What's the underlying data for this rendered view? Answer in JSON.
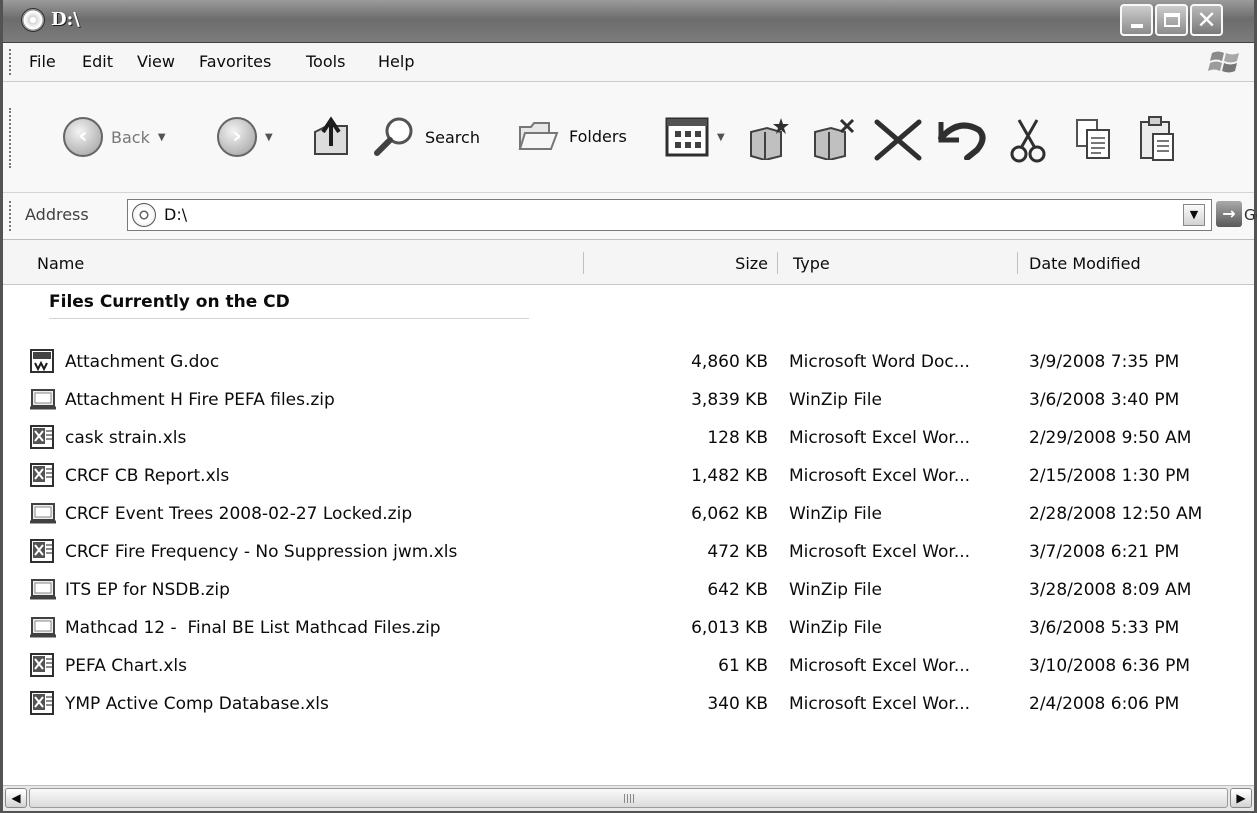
{
  "window": {
    "title": "D:\\",
    "icon": "cd-drive-icon",
    "controls": [
      "minimize",
      "maximize",
      "close"
    ]
  },
  "menu": {
    "items": [
      "File",
      "Edit",
      "View",
      "Favorites",
      "Tools",
      "Help"
    ]
  },
  "toolbar": {
    "back_label": "Back",
    "search_label": "Search",
    "folders_label": "Folders"
  },
  "address": {
    "label": "Address",
    "value": "D:\\",
    "go_label": "Go"
  },
  "columns": {
    "name": "Name",
    "size": "Size",
    "type": "Type",
    "date": "Date Modified"
  },
  "group": {
    "heading": "Files Currently on the CD"
  },
  "files": [
    {
      "name": "Attachment G.doc",
      "size": "4,860 KB",
      "type": "Microsoft Word Doc...",
      "date": "3/9/2008 7:35 PM",
      "icon": "word-doc-icon"
    },
    {
      "name": "Attachment H Fire PEFA files.zip",
      "size": "3,839 KB",
      "type": "WinZip File",
      "date": "3/6/2008 3:40 PM",
      "icon": "zip-file-icon"
    },
    {
      "name": "cask strain.xls",
      "size": "128 KB",
      "type": "Microsoft Excel Wor...",
      "date": "2/29/2008 9:50 AM",
      "icon": "excel-file-icon"
    },
    {
      "name": "CRCF CB Report.xls",
      "size": "1,482 KB",
      "type": "Microsoft Excel Wor...",
      "date": "2/15/2008 1:30 PM",
      "icon": "excel-file-icon"
    },
    {
      "name": "CRCF Event Trees 2008-02-27 Locked.zip",
      "size": "6,062 KB",
      "type": "WinZip File",
      "date": "2/28/2008 12:50 AM",
      "icon": "zip-file-icon"
    },
    {
      "name": "CRCF Fire Frequency - No Suppression jwm.xls",
      "size": "472 KB",
      "type": "Microsoft Excel Wor...",
      "date": "3/7/2008 6:21 PM",
      "icon": "excel-file-icon"
    },
    {
      "name": "ITS EP for NSDB.zip",
      "size": "642 KB",
      "type": "WinZip File",
      "date": "3/28/2008 8:09 AM",
      "icon": "zip-file-icon"
    },
    {
      "name": "Mathcad 12 -  Final BE List Mathcad Files.zip",
      "size": "6,013 KB",
      "type": "WinZip File",
      "date": "3/6/2008 5:33 PM",
      "icon": "zip-file-icon"
    },
    {
      "name": "PEFA Chart.xls",
      "size": "61 KB",
      "type": "Microsoft Excel Wor...",
      "date": "3/10/2008 6:36 PM",
      "icon": "excel-file-icon"
    },
    {
      "name": "YMP Active Comp Database.xls",
      "size": "340 KB",
      "type": "Microsoft Excel Wor...",
      "date": "2/4/2008 6:06 PM",
      "icon": "excel-file-icon"
    }
  ]
}
